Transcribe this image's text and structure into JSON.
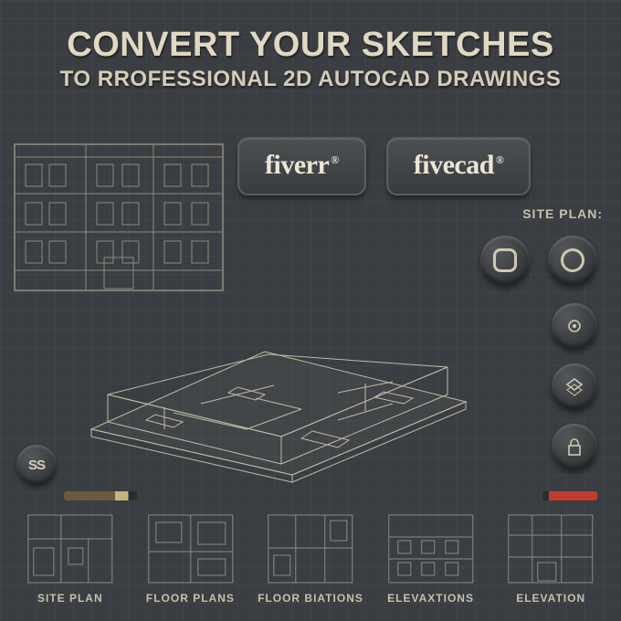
{
  "heading": {
    "line1": "CONVERT YOUR SKETCHES",
    "line2": "TO RROFESSIONAL 2D AUTOCAD DRAWINGS"
  },
  "brands": {
    "fiverr": "fiverr",
    "fivecad": "fivecad",
    "registered": "®"
  },
  "labels": {
    "site_plan_side": "SITE PLAN:"
  },
  "ss_button": "SS",
  "thumbnails": [
    {
      "caption": "SITE PLAN"
    },
    {
      "caption": "FLOOR PLANS"
    },
    {
      "caption": "FLOOR BIATIONS"
    },
    {
      "caption": "ELEVAXTIONS"
    },
    {
      "caption": "ELEVATION"
    }
  ]
}
